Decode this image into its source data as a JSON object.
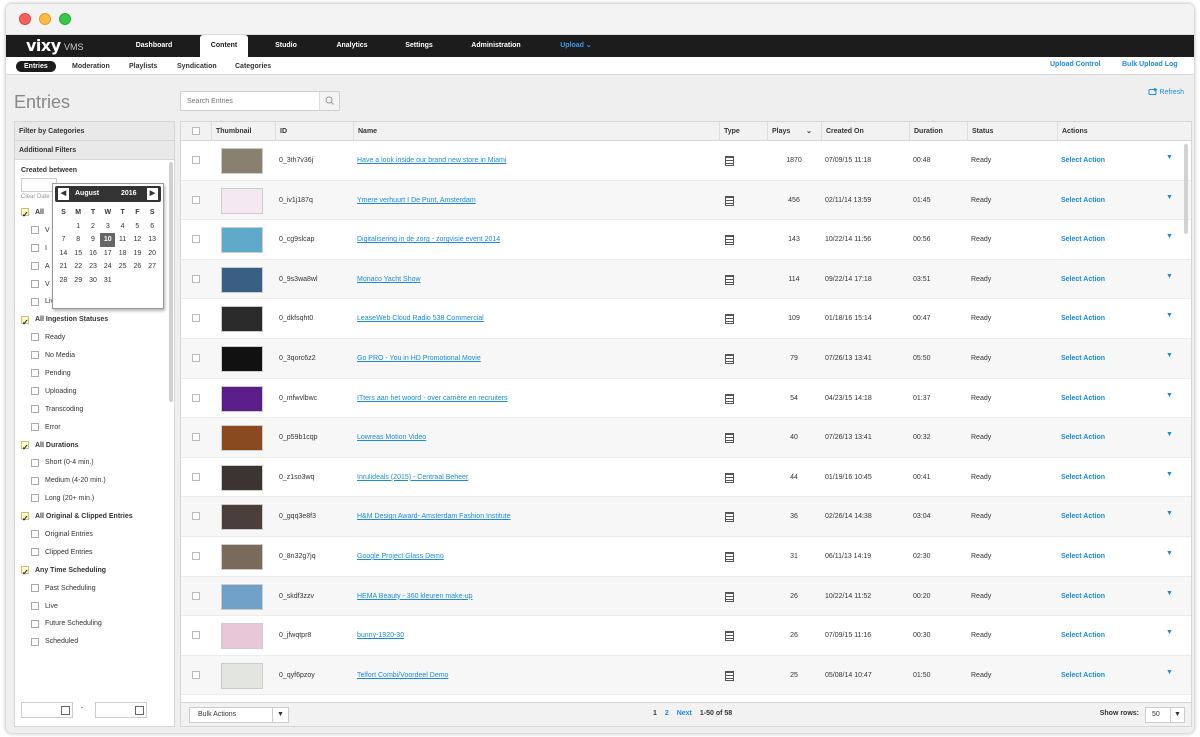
{
  "app": {
    "logo": "vixy",
    "logo_sub": "VMS"
  },
  "topnav": [
    {
      "label": "Dashboard"
    },
    {
      "label": "Content"
    },
    {
      "label": "Studio"
    },
    {
      "label": "Analytics"
    },
    {
      "label": "Settings"
    },
    {
      "label": "Administration"
    },
    {
      "label": "Upload ⌄"
    }
  ],
  "subnav": {
    "items": [
      "Entries",
      "Moderation",
      "Playlists",
      "Syndication",
      "Categories"
    ],
    "upload_control": "Upload Control",
    "bulk_upload_log": "Bulk Upload Log"
  },
  "page": {
    "title": "Entries",
    "search_placeholder": "Search Entries",
    "refresh": "Refresh"
  },
  "sidebar": {
    "filter_by_categories": "Filter by Categories",
    "additional_filters": "Additional Filters",
    "created_between": "Created between",
    "clear_dates": "Clear Date",
    "date_separator": "-",
    "groups": [
      {
        "label": "All",
        "items": [
          "V",
          "I",
          "A",
          "V",
          "Live Stream"
        ]
      },
      {
        "label": "All Ingestion Statuses",
        "items": [
          "Ready",
          "No Media",
          "Pending",
          "Uploading",
          "Transcoding",
          "Error"
        ]
      },
      {
        "label": "All Durations",
        "items": [
          "Short (0-4 min.)",
          "Medium (4-20 min.)",
          "Long (20+ min.)"
        ]
      },
      {
        "label": "All Original & Clipped Entries",
        "items": [
          "Original Entries",
          "Clipped Entries"
        ]
      },
      {
        "label": "Any Time Scheduling",
        "items": [
          "Past Scheduling",
          "Live",
          "Future Scheduling",
          "Scheduled"
        ]
      }
    ]
  },
  "calendar": {
    "month": "August",
    "year": "2016",
    "prev": "◀",
    "next": "▶",
    "dow": [
      "S",
      "M",
      "T",
      "W",
      "T",
      "F",
      "S"
    ],
    "days": [
      "",
      "1",
      "2",
      "3",
      "4",
      "5",
      "6",
      "7",
      "8",
      "9",
      "10",
      "11",
      "12",
      "13",
      "14",
      "15",
      "16",
      "17",
      "18",
      "19",
      "20",
      "21",
      "22",
      "23",
      "24",
      "25",
      "26",
      "27",
      "28",
      "29",
      "30",
      "31",
      "",
      "",
      ""
    ],
    "selected_day": "10"
  },
  "table": {
    "headers": [
      "Thumbnail",
      "ID",
      "Name",
      "Type",
      "Plays",
      "Created On",
      "Duration",
      "Status",
      "Actions"
    ],
    "plays_sort_icon": "⌄",
    "action_label": "Select Action",
    "rows": [
      {
        "id": "0_3th7v36j",
        "name": "Have a look inside our brand new store in Miami",
        "plays": "1870",
        "created": "07/09/15 11:18",
        "duration": "00:48",
        "status": "Ready",
        "thumb": "#8a8070"
      },
      {
        "id": "0_iv1j187q",
        "name": "Ymere verhuurt I De Punt, Amsterdam",
        "plays": "456",
        "created": "02/11/14 13:59",
        "duration": "01:45",
        "status": "Ready",
        "thumb": "#f4e9f0"
      },
      {
        "id": "0_cg9slcap",
        "name": "Digitalisering in de zorg - zorgvisie event 2014",
        "plays": "143",
        "created": "10/22/14 11:56",
        "duration": "00:56",
        "status": "Ready",
        "thumb": "#5ea9c9"
      },
      {
        "id": "0_9s3wa8wl",
        "name": "Monaco Yacht Show",
        "plays": "114",
        "created": "09/22/14 17:18",
        "duration": "03:51",
        "status": "Ready",
        "thumb": "#3a5f85"
      },
      {
        "id": "0_dkfsqht0",
        "name": "LeaseWeb Cloud Radio 538 Commercial",
        "plays": "109",
        "created": "01/18/16 15:14",
        "duration": "00:47",
        "status": "Ready",
        "thumb": "#2a2a2a"
      },
      {
        "id": "0_3qorc6z2",
        "name": "Go PRO - You in HD Promotional Movie",
        "plays": "79",
        "created": "07/26/13 13:41",
        "duration": "05:50",
        "status": "Ready",
        "thumb": "#111111"
      },
      {
        "id": "0_mfwvlbwc",
        "name": "ITters aan het woord - over carrière en recruiters",
        "plays": "54",
        "created": "04/23/15 14:18",
        "duration": "01:37",
        "status": "Ready",
        "thumb": "#5b1d8a"
      },
      {
        "id": "0_p59b1cqp",
        "name": "Lowreas Motion Video",
        "plays": "40",
        "created": "07/26/13 13:41",
        "duration": "00:32",
        "status": "Ready",
        "thumb": "#8a4a1f"
      },
      {
        "id": "0_z1so3wq",
        "name": "Inrulideals (2015) - Centraal Beheer",
        "plays": "44",
        "created": "01/19/16 10:45",
        "duration": "00:41",
        "status": "Ready",
        "thumb": "#3c3430"
      },
      {
        "id": "0_gqq3e8f3",
        "name": "H&M Design Award- Amsterdam Fashion Institute",
        "plays": "36",
        "created": "02/26/14 14:38",
        "duration": "03:04",
        "status": "Ready",
        "thumb": "#4a3f3a"
      },
      {
        "id": "0_8n32g7jq",
        "name": "Google Project Glass Demo",
        "plays": "31",
        "created": "06/11/13 14:19",
        "duration": "02:30",
        "status": "Ready",
        "thumb": "#7a6a5a"
      },
      {
        "id": "0_skdf3zzv",
        "name": "HEMA Beauty - 360 kleuren make-up",
        "plays": "26",
        "created": "10/22/14 11:52",
        "duration": "00:20",
        "status": "Ready",
        "thumb": "#6fa0c8"
      },
      {
        "id": "0_jfwqtpr8",
        "name": "bunny-1920-30",
        "plays": "26",
        "created": "07/09/15 11:16",
        "duration": "00:30",
        "status": "Ready",
        "thumb": "#e8c7d8"
      },
      {
        "id": "0_qyf6pzoy",
        "name": "Telfort Combi/Voordeel Demo",
        "plays": "25",
        "created": "05/08/14 10:47",
        "duration": "01:50",
        "status": "Ready",
        "thumb": "#e3e6e0"
      }
    ]
  },
  "footer": {
    "bulk_actions": "Bulk Actions",
    "pages": [
      "1",
      "2"
    ],
    "next": "Next",
    "range": "1-50 of 58",
    "show_rows_label": "Show rows:",
    "show_rows_value": "50"
  },
  "colors": {
    "accent": "#1a8cd8",
    "nav_bg": "#1c1c1c",
    "check_bg": "#fffbc7"
  }
}
